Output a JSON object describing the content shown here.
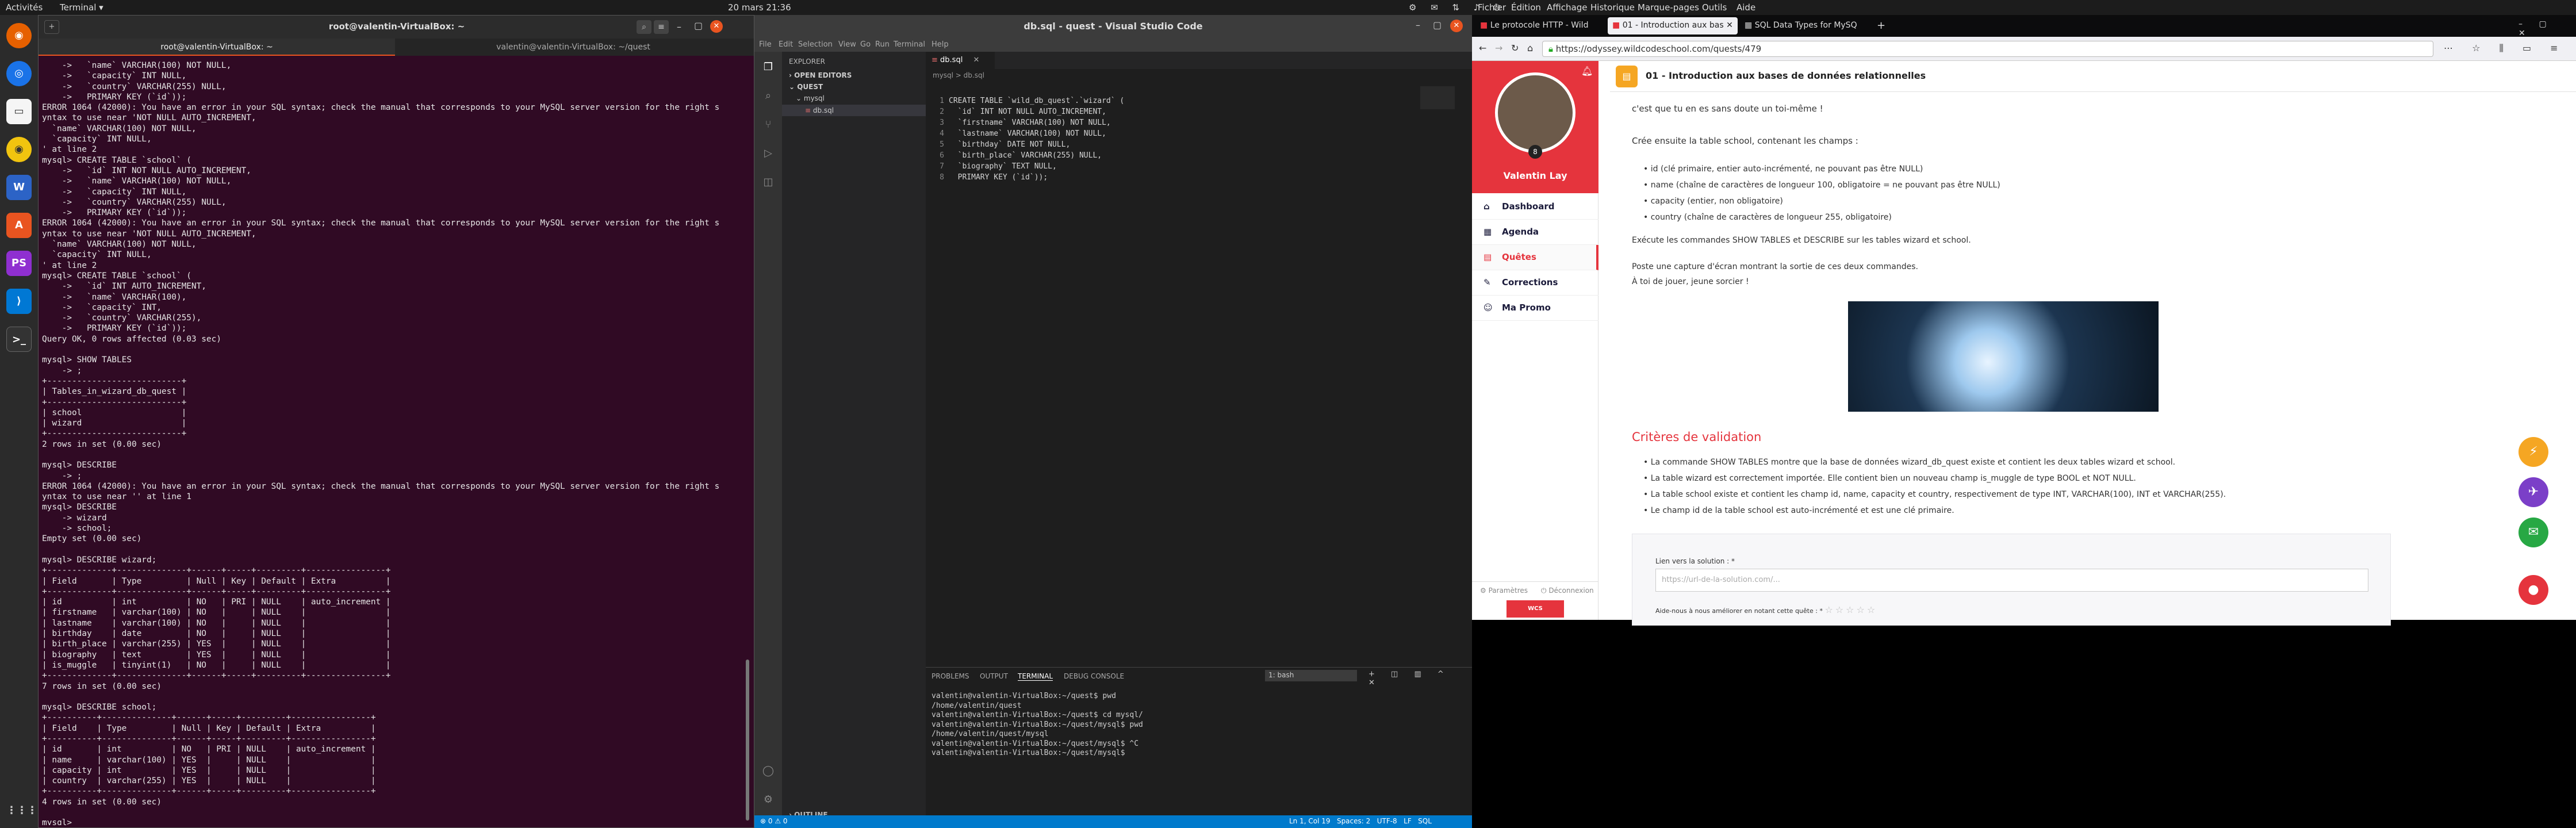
{
  "topbar": {
    "activities": "Activités",
    "app_menu": "Terminal ▾",
    "clock": "20 mars  21:36"
  },
  "terminal": {
    "title": "root@valentin-VirtualBox: ~",
    "tabs": [
      "root@valentin-VirtualBox: ~",
      "valentin@valentin-VirtualBox: ~/quest"
    ],
    "text": "    ->   `name` VARCHAR(100) NOT NULL,\n    ->   `capacity` INT NULL,\n    ->   `country` VARCHAR(255) NULL,\n    ->   PRIMARY KEY (`id`));\nERROR 1064 (42000): You have an error in your SQL syntax; check the manual that corresponds to your MySQL server version for the right s\nyntax to use near 'NOT NULL AUTO_INCREMENT,\n  `name` VARCHAR(100) NOT NULL,\n  `capacity` INT NULL,\n' at line 2\nmysql> CREATE TABLE `school` (\n    ->   `id` INT NOT NULL AUTO_INCREMENT,\n    ->   `name` VARCHAR(100) NOT NULL,\n    ->   `capacity` INT NULL,\n    ->   `country` VARCHAR(255) NULL,\n    ->   PRIMARY KEY (`id`));\nERROR 1064 (42000): You have an error in your SQL syntax; check the manual that corresponds to your MySQL server version for the right s\nyntax to use near 'NOT NULL AUTO_INCREMENT,\n  `name` VARCHAR(100) NOT NULL,\n  `capacity` INT NULL,\n' at line 2\nmysql> CREATE TABLE `school` (\n    ->   `id` INT AUTO_INCREMENT,\n    ->   `name` VARCHAR(100),\n    ->   `capacity` INT,\n    ->   `country` VARCHAR(255),\n    ->   PRIMARY KEY (`id`));\nQuery OK, 0 rows affected (0.03 sec)\n\nmysql> SHOW TABLES\n    -> ;\n+---------------------------+\n| Tables_in_wizard_db_quest |\n+---------------------------+\n| school                    |\n| wizard                    |\n+---------------------------+\n2 rows in set (0.00 sec)\n\nmysql> DESCRIBE\n    -> ;\nERROR 1064 (42000): You have an error in your SQL syntax; check the manual that corresponds to your MySQL server version for the right s\nyntax to use near '' at line 1\nmysql> DESCRIBE\n    -> wizard\n    -> school;\nEmpty set (0.00 sec)\n\nmysql> DESCRIBE wizard;\n+-------------+--------------+------+-----+---------+----------------+\n| Field       | Type         | Null | Key | Default | Extra          |\n+-------------+--------------+------+-----+---------+----------------+\n| id          | int          | NO   | PRI | NULL    | auto_increment |\n| firstname   | varchar(100) | NO   |     | NULL    |                |\n| lastname    | varchar(100) | NO   |     | NULL    |                |\n| birthday    | date         | NO   |     | NULL    |                |\n| birth_place | varchar(255) | YES  |     | NULL    |                |\n| biography   | text         | YES  |     | NULL    |                |\n| is_muggle   | tinyint(1)   | NO   |     | NULL    |                |\n+-------------+--------------+------+-----+---------+----------------+\n7 rows in set (0.00 sec)\n\nmysql> DESCRIBE school;\n+----------+--------------+------+-----+---------+----------------+\n| Field    | Type         | Null | Key | Default | Extra          |\n+----------+--------------+------+-----+---------+----------------+\n| id       | int          | NO   | PRI | NULL    | auto_increment |\n| name     | varchar(100) | YES  |     | NULL    |                |\n| capacity | int          | YES  |     | NULL    |                |\n| country  | varchar(255) | YES  |     | NULL    |                |\n+----------+--------------+------+-----+---------+----------------+\n4 rows in set (0.00 sec)\n\nmysql> "
  },
  "vscode": {
    "title": "db.sql - quest - Visual Studio Code",
    "menu": [
      "File",
      "Edit",
      "Selection",
      "View",
      "Go",
      "Run",
      "Terminal",
      "Help"
    ],
    "explorer_label": "EXPLORER",
    "open_editors": "OPEN EDITORS",
    "folder": "QUEST",
    "subfolder": "mysql",
    "file": "db.sql",
    "tab": "db.sql",
    "breadcrumb": "mysql > db.sql",
    "line_numbers": "1\n2\n3\n4\n5\n6\n7\n8",
    "code": "CREATE TABLE `wild_db_quest`.`wizard` (\n  `id` INT NOT NULL AUTO_INCREMENT,\n  `firstname` VARCHAR(100) NOT NULL,\n  `lastname` VARCHAR(100) NOT NULL,\n  `birthday` DATE NOT NULL,\n  `birth_place` VARCHAR(255) NULL,\n  `biography` TEXT NULL,\n  PRIMARY KEY (`id`));",
    "panel_tabs": [
      "PROBLEMS",
      "OUTPUT",
      "TERMINAL",
      "DEBUG CONSOLE"
    ],
    "panel_select": "1: bash",
    "panel_text": "valentin@valentin-VirtualBox:~/quest$ pwd\n/home/valentin/quest\nvalentin@valentin-VirtualBox:~/quest$ cd mysql/\nvalentin@valentin-VirtualBox:~/quest/mysql$ pwd\n/home/valentin/quest/mysql\nvalentin@valentin-VirtualBox:~/quest/mysql$ ^C\nvalentin@valentin-VirtualBox:~/quest/mysql$ ",
    "outline": "OUTLINE",
    "status_left": "⊗ 0 ⚠ 0",
    "status_right": "Ln 1, Col 19   Spaces: 2   UTF-8   LF   SQL"
  },
  "firefox": {
    "menu": [
      "Fichier",
      "Édition",
      "Affichage",
      "Historique",
      "Marque-pages",
      "Outils",
      "Aide"
    ],
    "tabs": [
      "Le protocole HTTP - Wild",
      "01 - Introduction aux bas",
      "SQL Data Types for MySQ"
    ],
    "url": "https://odyssey.wildcodeschool.com/quests/479",
    "quest_title": "01 - Introduction aux bases de données relationnelles",
    "user_name": "Valentin Lay",
    "nav": [
      "Dashboard",
      "Agenda",
      "Quêtes",
      "Corrections",
      "Ma Promo"
    ],
    "footer_left": "Paramètres",
    "footer_right": "Déconnexion",
    "p1": "c'est que tu en es sans doute un toi-même !",
    "p2": "Crée ensuite la table school, contenant les champs :",
    "bullets": [
      "id (clé primaire, entier auto-incrémenté, ne pouvant pas être NULL)",
      "name (chaîne de caractères de longueur 100, obligatoire = ne pouvant pas être NULL)",
      "capacity (entier, non obligatoire)",
      "country (chaîne de caractères de longueur 255, obligatoire)"
    ],
    "p3": "Exécute les commandes SHOW TABLES et DESCRIBE sur les tables wizard et school.",
    "p4": "Poste une capture d'écran montrant la sortie de ces deux commandes.",
    "p5": "À toi de jouer, jeune sorcier !",
    "criteria_title": "Critères de validation",
    "criteria": [
      "La commande SHOW TABLES montre que la base de données wizard_db_quest existe et contient les deux tables wizard et school.",
      "La table wizard est correctement importée. Elle contient bien un nouveau champ is_muggle de type BOOL et NOT NULL.",
      "La table school existe et contient les champ id, name, capacity et country, respectivement de type INT, VARCHAR(100), INT et VARCHAR(255).",
      "Le champ id de la table school est auto-incrémenté et est une clé primaire."
    ],
    "solution_label": "Lien vers la solution : *",
    "solution_placeholder": "https://url-de-la-solution.com/...",
    "rating_label": "Aide-nous à nous améliorer en notant cette quête : *"
  },
  "colors": {
    "vscode_blue": "#007acc",
    "wild_red": "#e5343d",
    "terminal_bg": "#300a24"
  }
}
